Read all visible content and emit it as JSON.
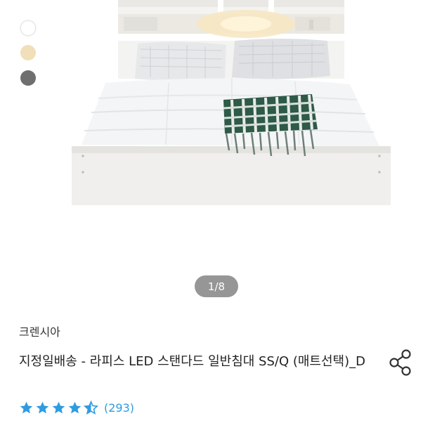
{
  "product_image": {
    "alt_subject": "bed",
    "color_swatches": [
      {
        "name": "white",
        "color": "#ffffff"
      },
      {
        "name": "beige",
        "color": "#f1dfb9"
      },
      {
        "name": "gray",
        "color": "#6f6f6f"
      }
    ],
    "pager": "1/8"
  },
  "product": {
    "brand": "크렌시아",
    "title": "지정일배송 - 라피스 LED 스탠다드 일반침대 SS/Q (매트선택)_D",
    "rating": 4.5,
    "review_count": "(293)",
    "star_color": "#2f9be0"
  }
}
